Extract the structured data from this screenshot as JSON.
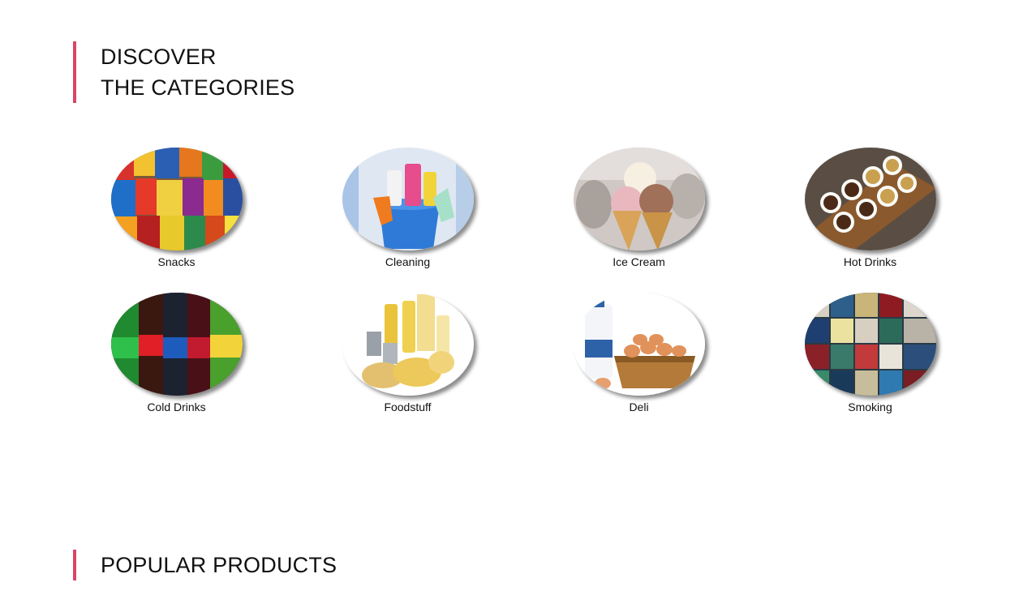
{
  "discover": {
    "line1": "DISCOVER",
    "line2": "THE CATEGORIES"
  },
  "categories": [
    {
      "label": "Snacks",
      "icon": "snacks-image"
    },
    {
      "label": "Cleaning",
      "icon": "cleaning-image"
    },
    {
      "label": "Ice Cream",
      "icon": "ice-cream-image"
    },
    {
      "label": "Hot Drinks",
      "icon": "hot-drinks-image"
    },
    {
      "label": "Cold Drinks",
      "icon": "cold-drinks-image"
    },
    {
      "label": "Foodstuff",
      "icon": "foodstuff-image"
    },
    {
      "label": "Deli",
      "icon": "deli-image"
    },
    {
      "label": "Smoking",
      "icon": "smoking-image"
    }
  ],
  "popular": {
    "title": "POPULAR PRODUCTS"
  },
  "colors": {
    "accent": "#d9456a",
    "text": "#111111"
  }
}
